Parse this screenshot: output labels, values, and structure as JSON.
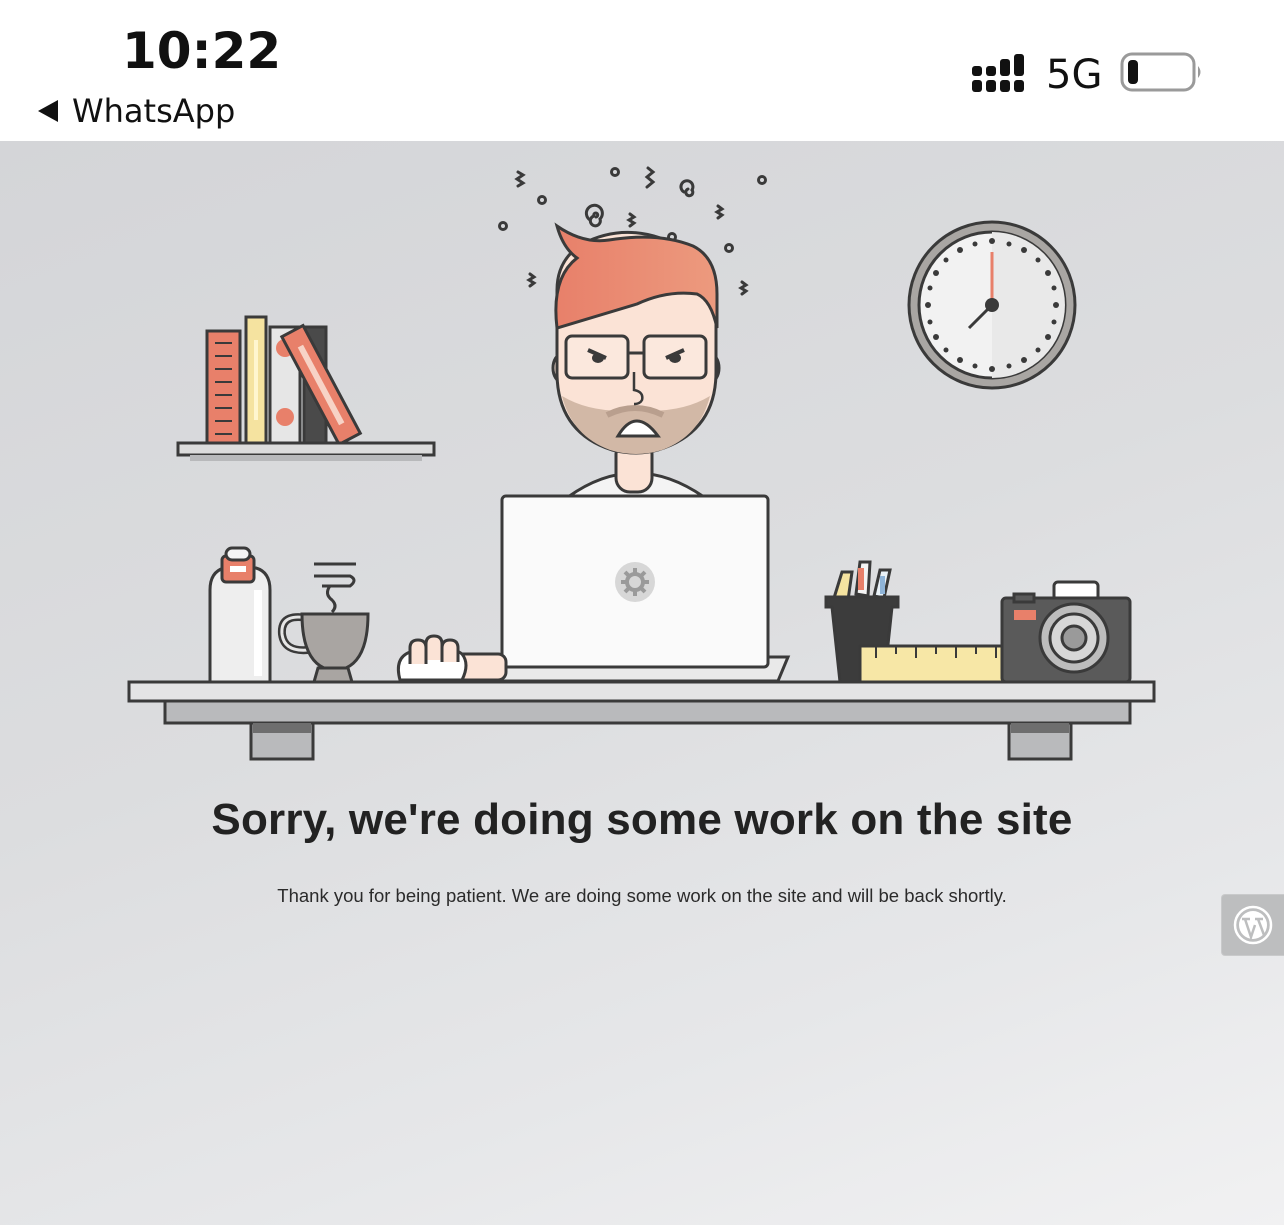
{
  "status_bar": {
    "time": "10:22",
    "back_app": "WhatsApp",
    "network": "5G",
    "icons": [
      "back-arrow-icon",
      "signal-icon",
      "battery-icon"
    ]
  },
  "maintenance": {
    "headline": "Sorry, we're doing some work on the site",
    "message": "Thank you for being patient. We are doing some work on the site and will be back shortly.",
    "badge_icon": "wordpress-logo-icon"
  },
  "colors": {
    "accent": "#e8806a",
    "background": "#d9dadc",
    "text": "#222222",
    "outline": "#3a3a3a"
  }
}
